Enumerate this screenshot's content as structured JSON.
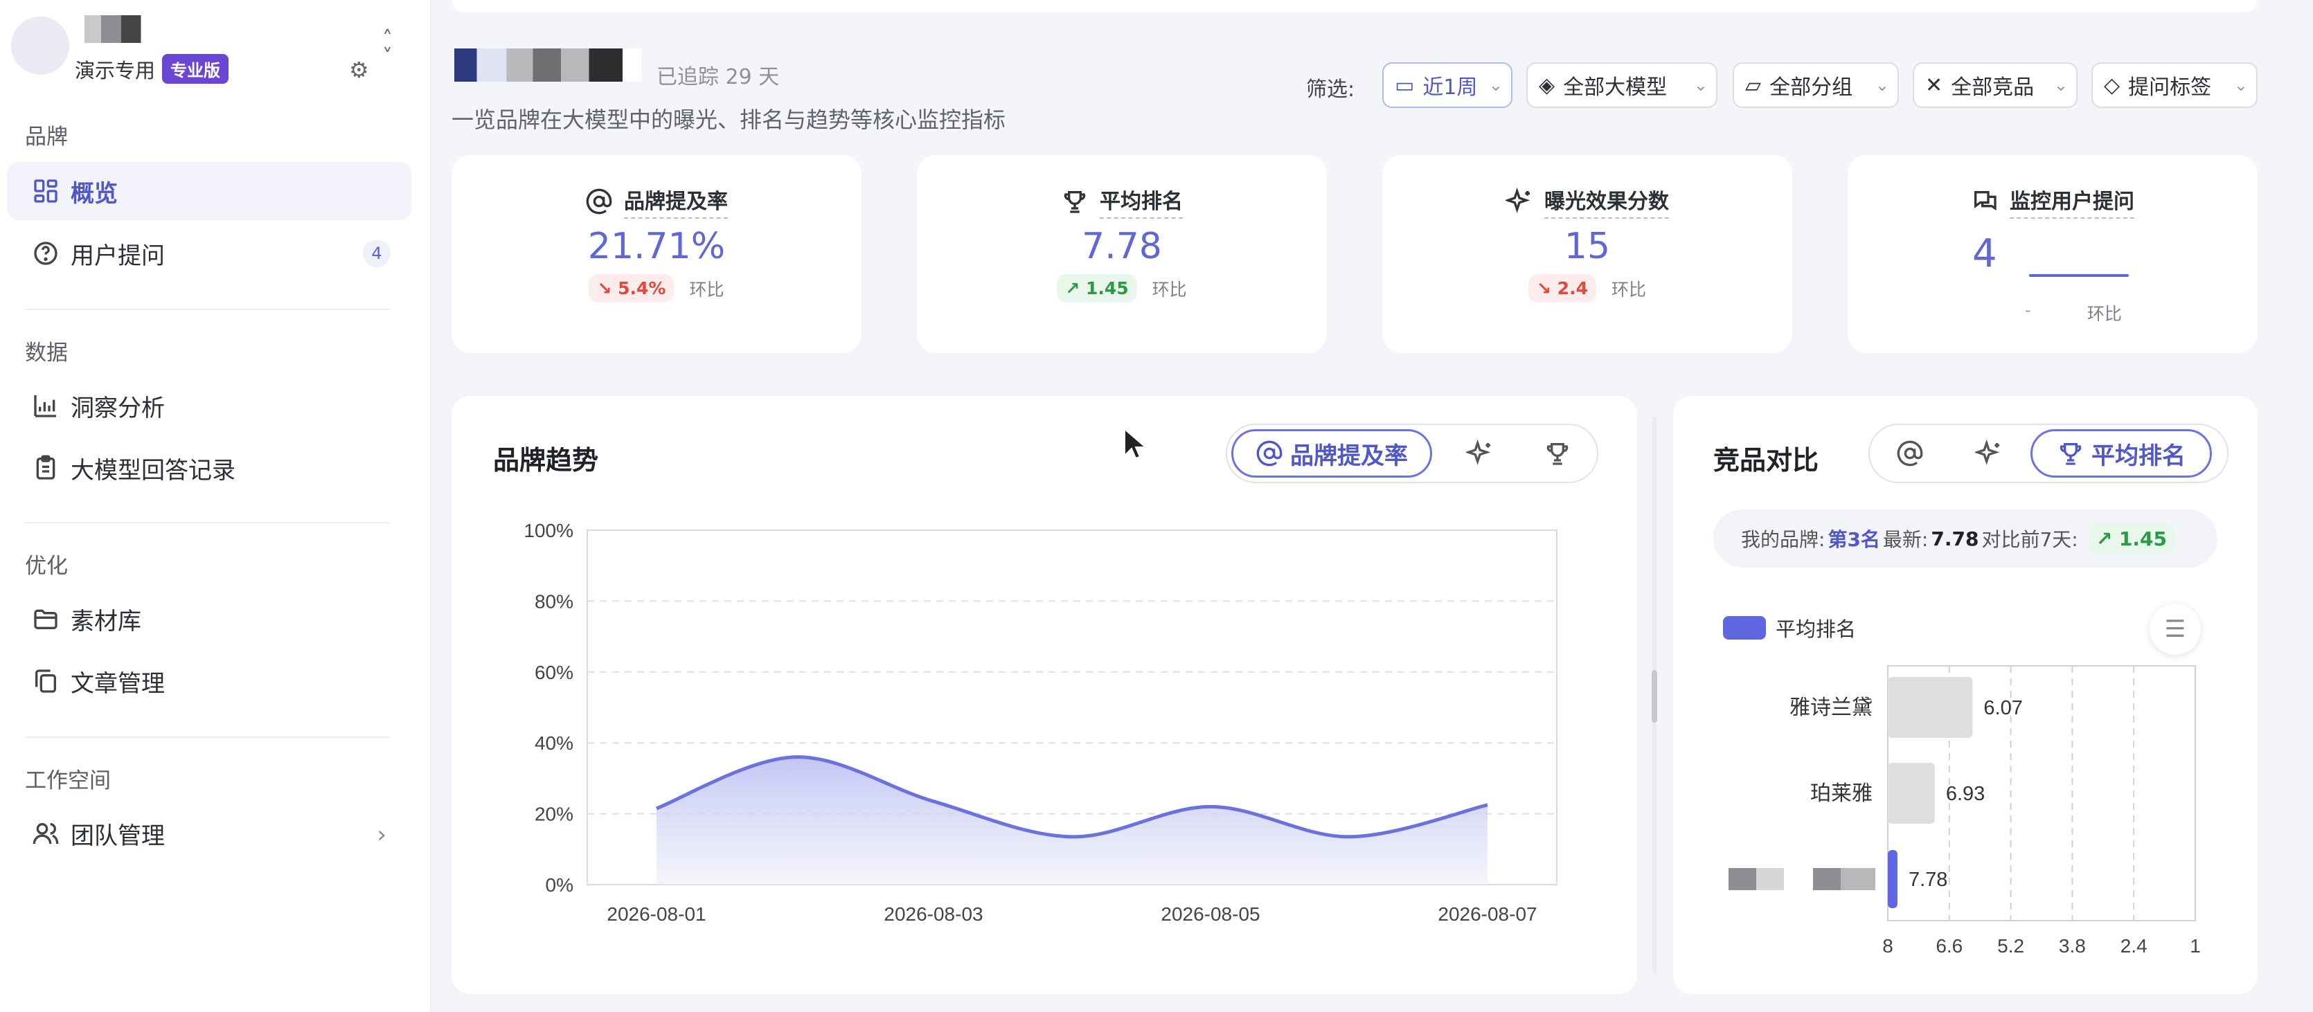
{
  "sidebar": {
    "workspace_name": "",
    "workspace_sub": "演示专用",
    "plan_badge": "专业版",
    "groups": {
      "brand": "品牌",
      "data": "数据",
      "optimize": "优化",
      "workspace": "工作空间"
    },
    "items": [
      {
        "label": "概览",
        "icon": "grid-icon"
      },
      {
        "label": "用户提问",
        "icon": "question-icon",
        "badge": "4"
      },
      {
        "label": "洞察分析",
        "icon": "chart-line-icon"
      },
      {
        "label": "大模型回答记录",
        "icon": "clipboard-icon"
      },
      {
        "label": "素材库",
        "icon": "folder-icon"
      },
      {
        "label": "文章管理",
        "icon": "copy-icon"
      },
      {
        "label": "团队管理",
        "icon": "users-icon"
      }
    ]
  },
  "header": {
    "tracked": "已追踪 29 天",
    "subtitle": "一览品牌在大模型中的曝光、排名与趋势等核心监控指标"
  },
  "filters": {
    "label": "筛选:",
    "period": "近1周",
    "model": "全部大模型",
    "group": "全部分组",
    "competitor": "全部竞品",
    "tag": "提问标签"
  },
  "metrics": [
    {
      "title": "品牌提及率",
      "value": "21.71%",
      "change": "5.4%",
      "trend": "down",
      "compare": "环比",
      "icon": "at-icon"
    },
    {
      "title": "平均排名",
      "value": "7.78",
      "change": "1.45",
      "trend": "up",
      "compare": "环比",
      "icon": "trophy-icon"
    },
    {
      "title": "曝光效果分数",
      "value": "15",
      "change": "2.4",
      "trend": "down",
      "compare": "环比",
      "icon": "sparkle-icon"
    },
    {
      "title": "监控用户提问",
      "value": "4",
      "change": "-",
      "compare": "环比",
      "icon": "chat-icon"
    }
  ],
  "trend": {
    "title": "品牌趋势",
    "tab_active": "品牌提及率"
  },
  "compare": {
    "title": "竞品对比",
    "tab_active": "平均排名",
    "my_brand_label": "我的品牌:",
    "my_rank": "第3名",
    "latest_label": "最新:",
    "latest_value": "7.78",
    "vs_label": "对比前7天:",
    "vs_change": "1.45",
    "legend": "平均排名"
  },
  "chart_data": [
    {
      "type": "area",
      "x": [
        "2026-08-01",
        "2026-08-02",
        "2026-08-03",
        "2026-08-04",
        "2026-08-05",
        "2026-08-06",
        "2026-08-07"
      ],
      "x_ticks": [
        "2026-08-01",
        "2026-08-03",
        "2026-08-05",
        "2026-08-07"
      ],
      "y_ticks": [
        "100%",
        "80%",
        "60%",
        "40%",
        "20%",
        "0%"
      ],
      "values": [
        21.5,
        36,
        23.5,
        13.5,
        22,
        13.5,
        22.5
      ],
      "ylim": [
        0,
        100
      ],
      "grid": true,
      "color": "#6b72e0"
    },
    {
      "type": "bar",
      "orientation": "horizontal",
      "categories": [
        "雅诗兰黛",
        "珀莱雅",
        ""
      ],
      "values": [
        6.07,
        6.93,
        7.78
      ],
      "value_labels": [
        "6.07",
        "6.93",
        "7.78"
      ],
      "x_ticks": [
        "8",
        "6.6",
        "5.2",
        "3.8",
        "2.4",
        "1"
      ],
      "xlim": [
        8,
        1
      ],
      "series_name": "平均排名",
      "colors": [
        "#dedede",
        "#dedede",
        "#5f67e0"
      ]
    }
  ]
}
